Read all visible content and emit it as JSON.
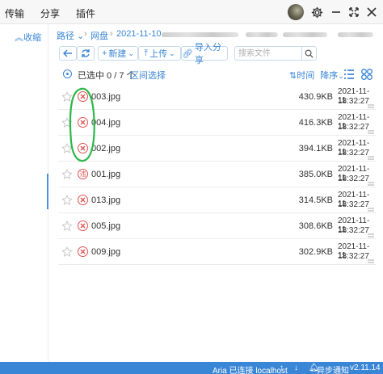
{
  "topbar": {
    "menus": [
      "传输",
      "分享",
      "插件"
    ]
  },
  "sidebar": {
    "collapse_label": "收缩"
  },
  "breadcrumb": {
    "items": [
      "路径",
      "网盘",
      "2021-11-10..."
    ]
  },
  "toolbar": {
    "new_label": "新建",
    "upload_label": "上传",
    "import_label": "导入分享",
    "search_placeholder": "搜索文件"
  },
  "selection": {
    "count_text": "已选中 0 / 7 个",
    "range_label": "区间选择"
  },
  "sort": {
    "field": "时间",
    "order": "降序"
  },
  "files": [
    {
      "name": "003.jpg",
      "size": "430.9KB",
      "date": "2021-11-11",
      "time": "18:32:27",
      "status": "error"
    },
    {
      "name": "004.jpg",
      "size": "416.3KB",
      "date": "2021-11-11",
      "time": "18:32:27",
      "status": "error"
    },
    {
      "name": "002.jpg",
      "size": "394.1KB",
      "date": "2021-11-11",
      "time": "18:32:27",
      "status": "error"
    },
    {
      "name": "001.jpg",
      "size": "385.0KB",
      "date": "2021-11-11",
      "time": "18:32:27",
      "status": "违"
    },
    {
      "name": "013.jpg",
      "size": "314.5KB",
      "date": "2021-11-11",
      "time": "18:32:27",
      "status": "error"
    },
    {
      "name": "005.jpg",
      "size": "308.6KB",
      "date": "2021-11-11",
      "time": "18:32:27",
      "status": "error"
    },
    {
      "name": "009.jpg",
      "size": "302.9KB",
      "date": "2021-11-11",
      "time": "18:32:27",
      "status": "error"
    }
  ],
  "statusbar": {
    "aria": "Aria 已连接 localhost",
    "sync": "异步通知",
    "version": "v2.11.14"
  },
  "colors": {
    "accent": "#3a86d6",
    "error": "#e05050",
    "annotation": "#2db84a"
  }
}
